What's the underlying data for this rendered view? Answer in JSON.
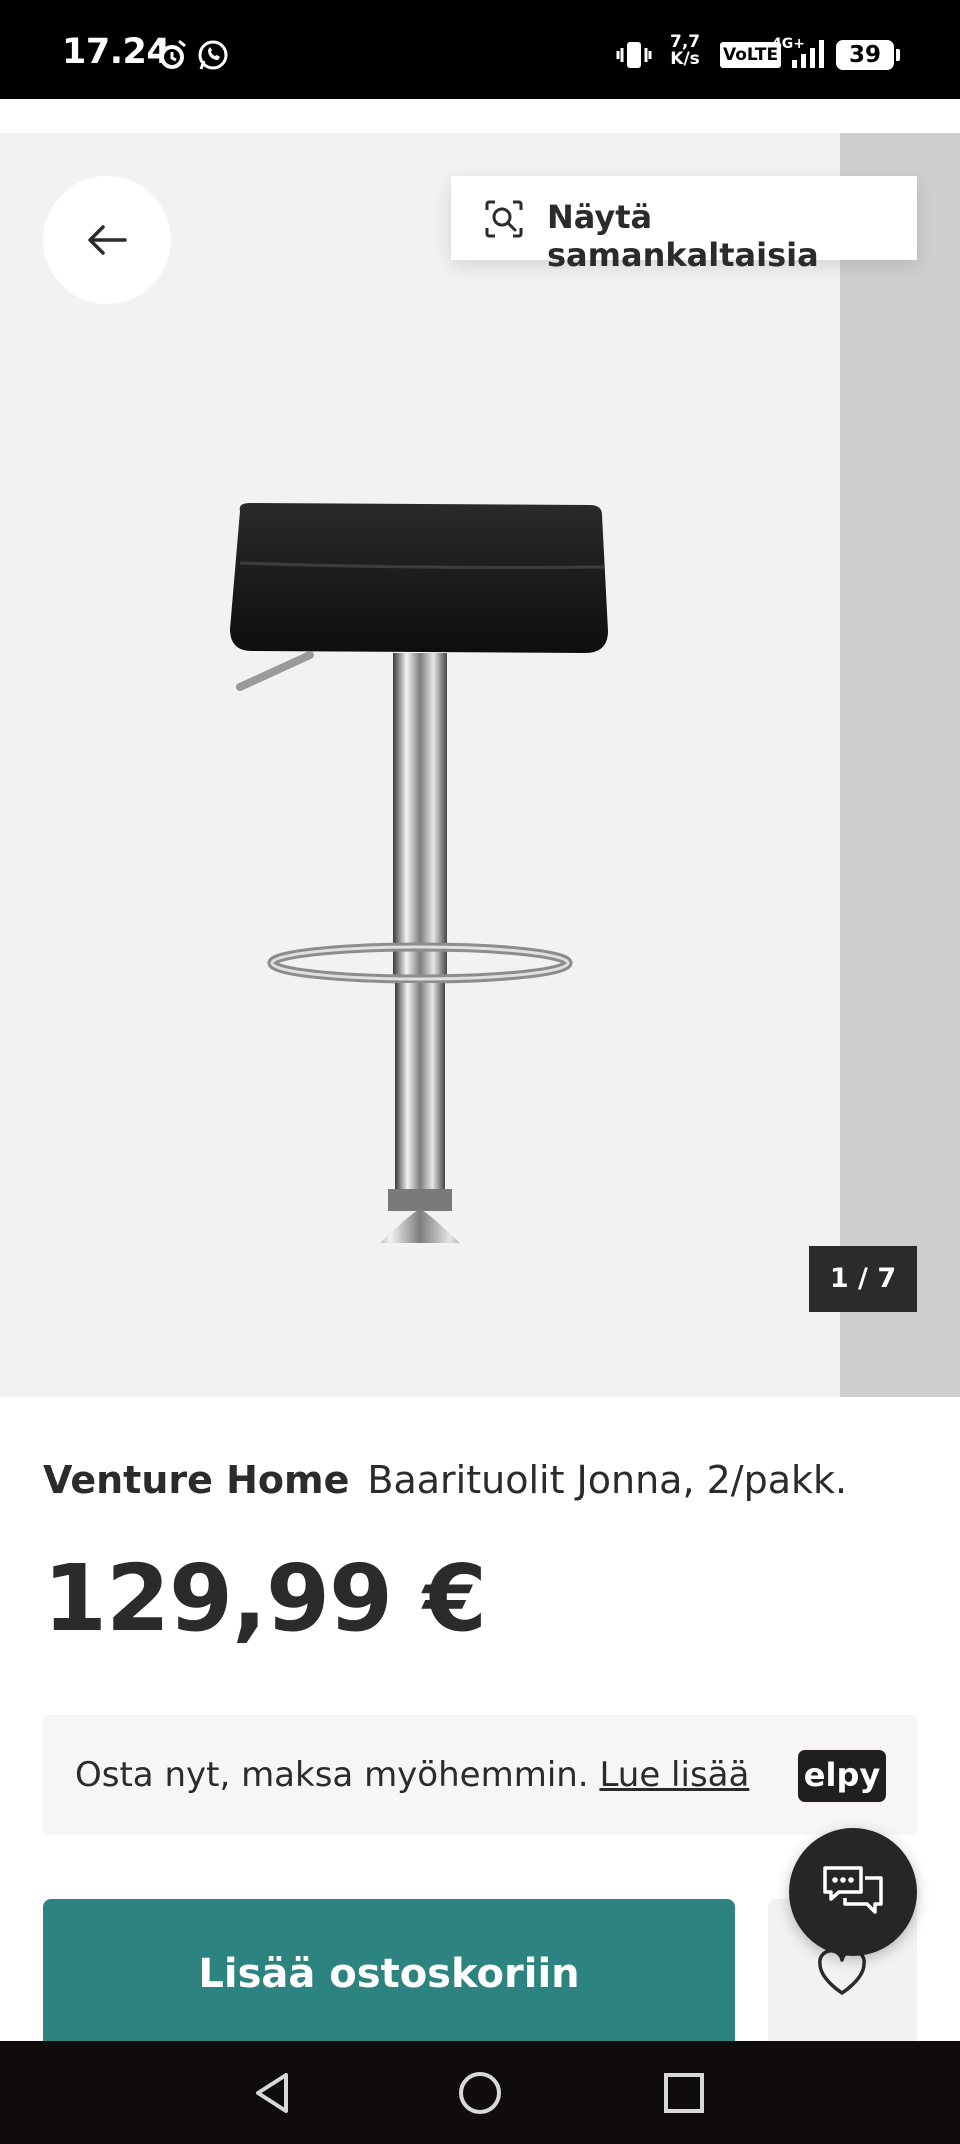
{
  "status_bar": {
    "time": "17.24",
    "speed_top": "7,7",
    "speed_bottom": "K/s",
    "volte": "VoLTE",
    "network": "4G+",
    "battery": "39"
  },
  "gallery": {
    "similar_label": "Näytä samankaltaisia",
    "counter": "1 / 7"
  },
  "product": {
    "brand": "Venture Home",
    "name": "Baarituolit Jonna, 2/pakk.",
    "price": "129,99 €"
  },
  "bnpl": {
    "text": "Osta nyt, maksa myöhemmin.",
    "link": "Lue lisää",
    "logo": "elpy"
  },
  "actions": {
    "add_to_cart": "Lisää ostoskoriin"
  },
  "icons": {
    "back": "arrow-left-icon",
    "similar": "visual-search-icon",
    "wishlist": "heart-icon",
    "chat": "chat-bubbles-icon"
  },
  "colors": {
    "primary_button": "#2d8380",
    "text": "#2b2b2b",
    "gallery_bg": "#f2f2f3"
  }
}
